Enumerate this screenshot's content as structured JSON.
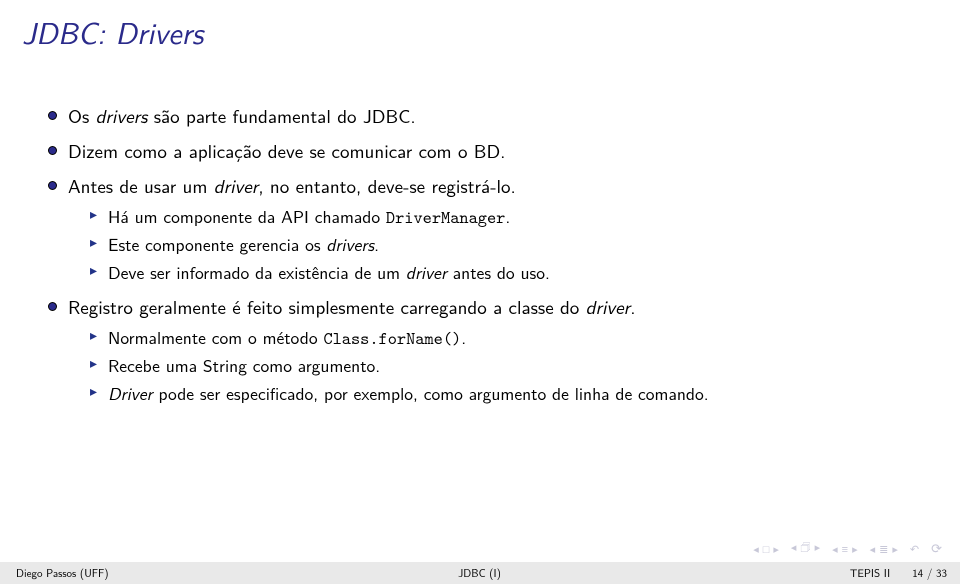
{
  "title": "JDBC: Drivers",
  "bullets": [
    {
      "pre": "Os ",
      "it": "drivers",
      "post": " são parte fundamental do JDBC."
    },
    {
      "text": "Dizem como a aplicação deve se comunicar com o BD."
    },
    {
      "pre": "Antes de usar um ",
      "it": "driver",
      "post": ", no entanto, deve-se registrá-lo.",
      "sub": [
        {
          "pre": "Há um componente da API chamado ",
          "tt": "DriverManager",
          "post": "."
        },
        {
          "pre": "Este componente gerencia os ",
          "it": "drivers",
          "post": "."
        },
        {
          "pre": "Deve ser informado da existência de um ",
          "it": "driver",
          "post": " antes do uso."
        }
      ]
    },
    {
      "pre": "Registro geralmente é feito simplesmente carregando a classe do ",
      "it": "driver",
      "post": ".",
      "sub": [
        {
          "pre": "Normalmente com o método ",
          "tt": "Class.forName()",
          "post": "."
        },
        {
          "text": "Recebe uma String como argumento."
        },
        {
          "it": "Driver",
          "post": " pode ser especificado, por exemplo, como argumento de linha de comando."
        }
      ]
    }
  ],
  "footer": {
    "left": "Diego Passos (UFF)",
    "center": "JDBC (I)",
    "course": "TEPIS II",
    "page": "14 / 33"
  }
}
